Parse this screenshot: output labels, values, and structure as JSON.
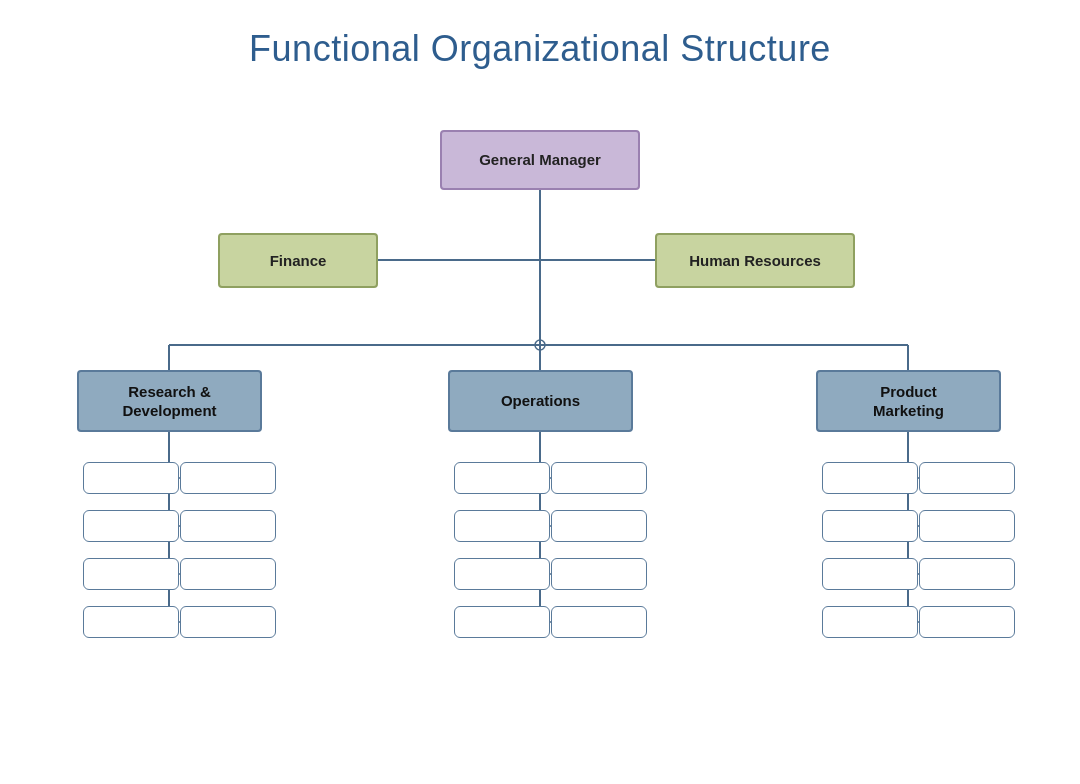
{
  "title": "Functional Organizational Structure",
  "nodes": {
    "gm": "General Manager",
    "finance": "Finance",
    "hr": "Human Resources",
    "rd": "Research &\nDevelopment",
    "ops": "Operations",
    "pm": "Product\nMarketing"
  },
  "colors": {
    "gm_bg": "#c9b8d8",
    "gm_border": "#9a80b0",
    "staff_bg": "#c8d4a0",
    "staff_border": "#8fa060",
    "dept_bg": "#8faabf",
    "dept_border": "#5a7a9a",
    "line": "#4a6a8a"
  }
}
